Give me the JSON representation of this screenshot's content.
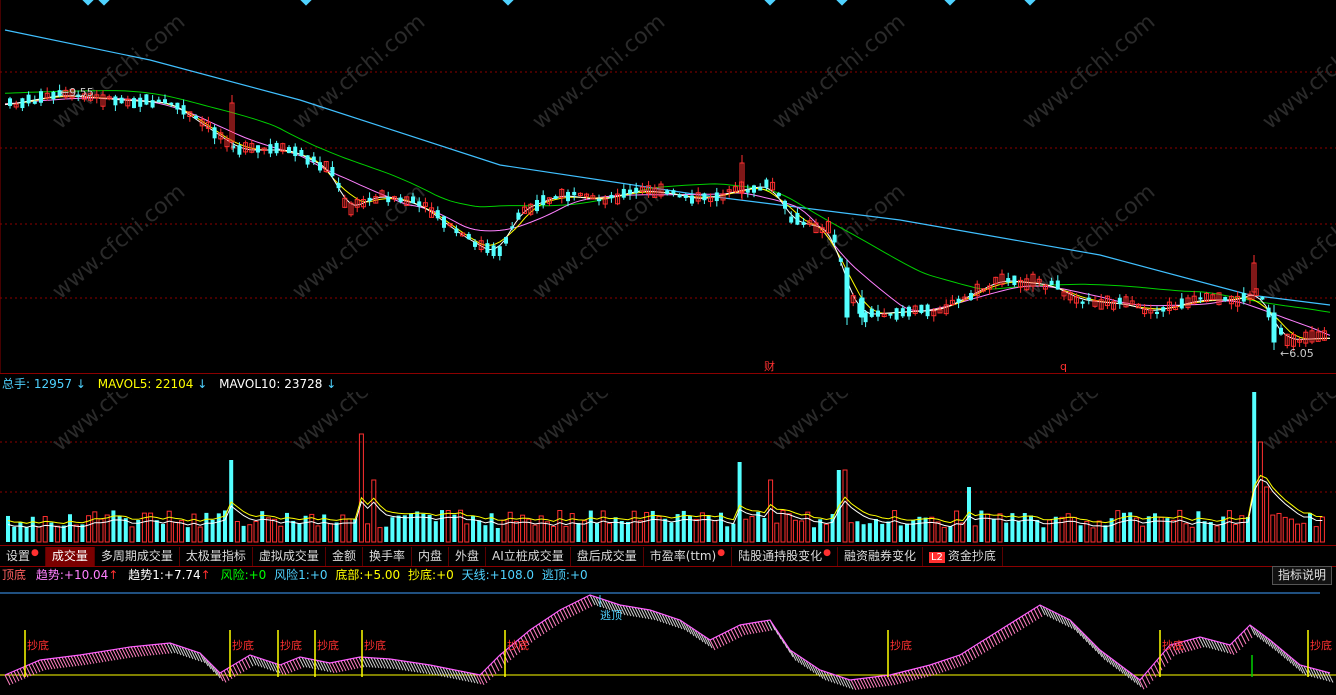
{
  "price_chart": {
    "high_label": "9.55",
    "low_label": "6.05",
    "marker_cai": "财",
    "marker_q": "q",
    "watermark": "www.cfchi.com",
    "colors": {
      "up": "#ff3030",
      "down": "#54ffff",
      "ma_white": "#ffffff",
      "ma_yellow": "#ffff00",
      "ma_magenta": "#ff80ff",
      "ma_green": "#00d000",
      "ma_blue": "#40c0ff",
      "grid": "#8b0000",
      "diamond": "#4fd2ff"
    }
  },
  "volume": {
    "total_label": "总手:",
    "total_value": "12957",
    "mavol5_label": "MAVOL5:",
    "mavol5_value": "22104",
    "mavol10_label": "MAVOL10:",
    "mavol10_value": "23728",
    "arrow_down": "↓"
  },
  "tabs": [
    {
      "label": "设置",
      "dot": true
    },
    {
      "label": "成交量",
      "active": true
    },
    {
      "label": "多周期成交量"
    },
    {
      "label": "太极量指标"
    },
    {
      "label": "虚拟成交量"
    },
    {
      "label": "金额"
    },
    {
      "label": "换手率"
    },
    {
      "label": "内盘"
    },
    {
      "label": "外盘"
    },
    {
      "label": "AI立桩成交量"
    },
    {
      "label": "盘后成交量"
    },
    {
      "label": "市盈率(ttm)",
      "dot": true
    },
    {
      "label": "陆股通持股变化",
      "dot": true
    },
    {
      "label": "融资融券变化"
    },
    {
      "label": "资金抄底",
      "badge": "L2"
    }
  ],
  "indicator": {
    "name": "顶底",
    "trend_label": "趋势:",
    "trend_value": "+10.04",
    "trend1_label": "趋势1:",
    "trend1_value": "+7.74",
    "risk_label": "风险:",
    "risk_value": "+0",
    "risk1_label": "风险1:",
    "risk1_value": "+0",
    "bottom_label": "底部:",
    "bottom_value": "+5.00",
    "buy_label": "抄底:",
    "buy_value": "+0",
    "sky_label": "天线:",
    "sky_value": "+108.0",
    "escape_label": "逃顶:",
    "escape_value": "+0",
    "arrow_up": "↑",
    "help_label": "指标说明",
    "signal_buy": "抄底",
    "signal_escape": "逃顶"
  }
}
